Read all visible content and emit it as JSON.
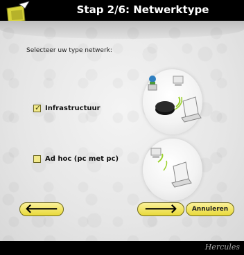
{
  "window": {
    "title": "Stap 2/6: Netwerktype"
  },
  "main": {
    "prompt": "Selecteer uw type netwerk:",
    "options": [
      {
        "label": "Infrastructuur",
        "checked": true
      },
      {
        "label": "Ad hoc (pc met pc)",
        "checked": false
      }
    ]
  },
  "buttons": {
    "back_icon": "arrow-left-icon",
    "back_glyph": "🡐",
    "next_icon": "arrow-right-icon",
    "next_glyph": "🡒",
    "cancel_label": "Annuleren"
  },
  "footer": {
    "brand": "Hercules"
  },
  "colors": {
    "button_fill": "#efe16a",
    "checkbox_fill": "#f2e98a",
    "title_text": "#ffffff"
  }
}
